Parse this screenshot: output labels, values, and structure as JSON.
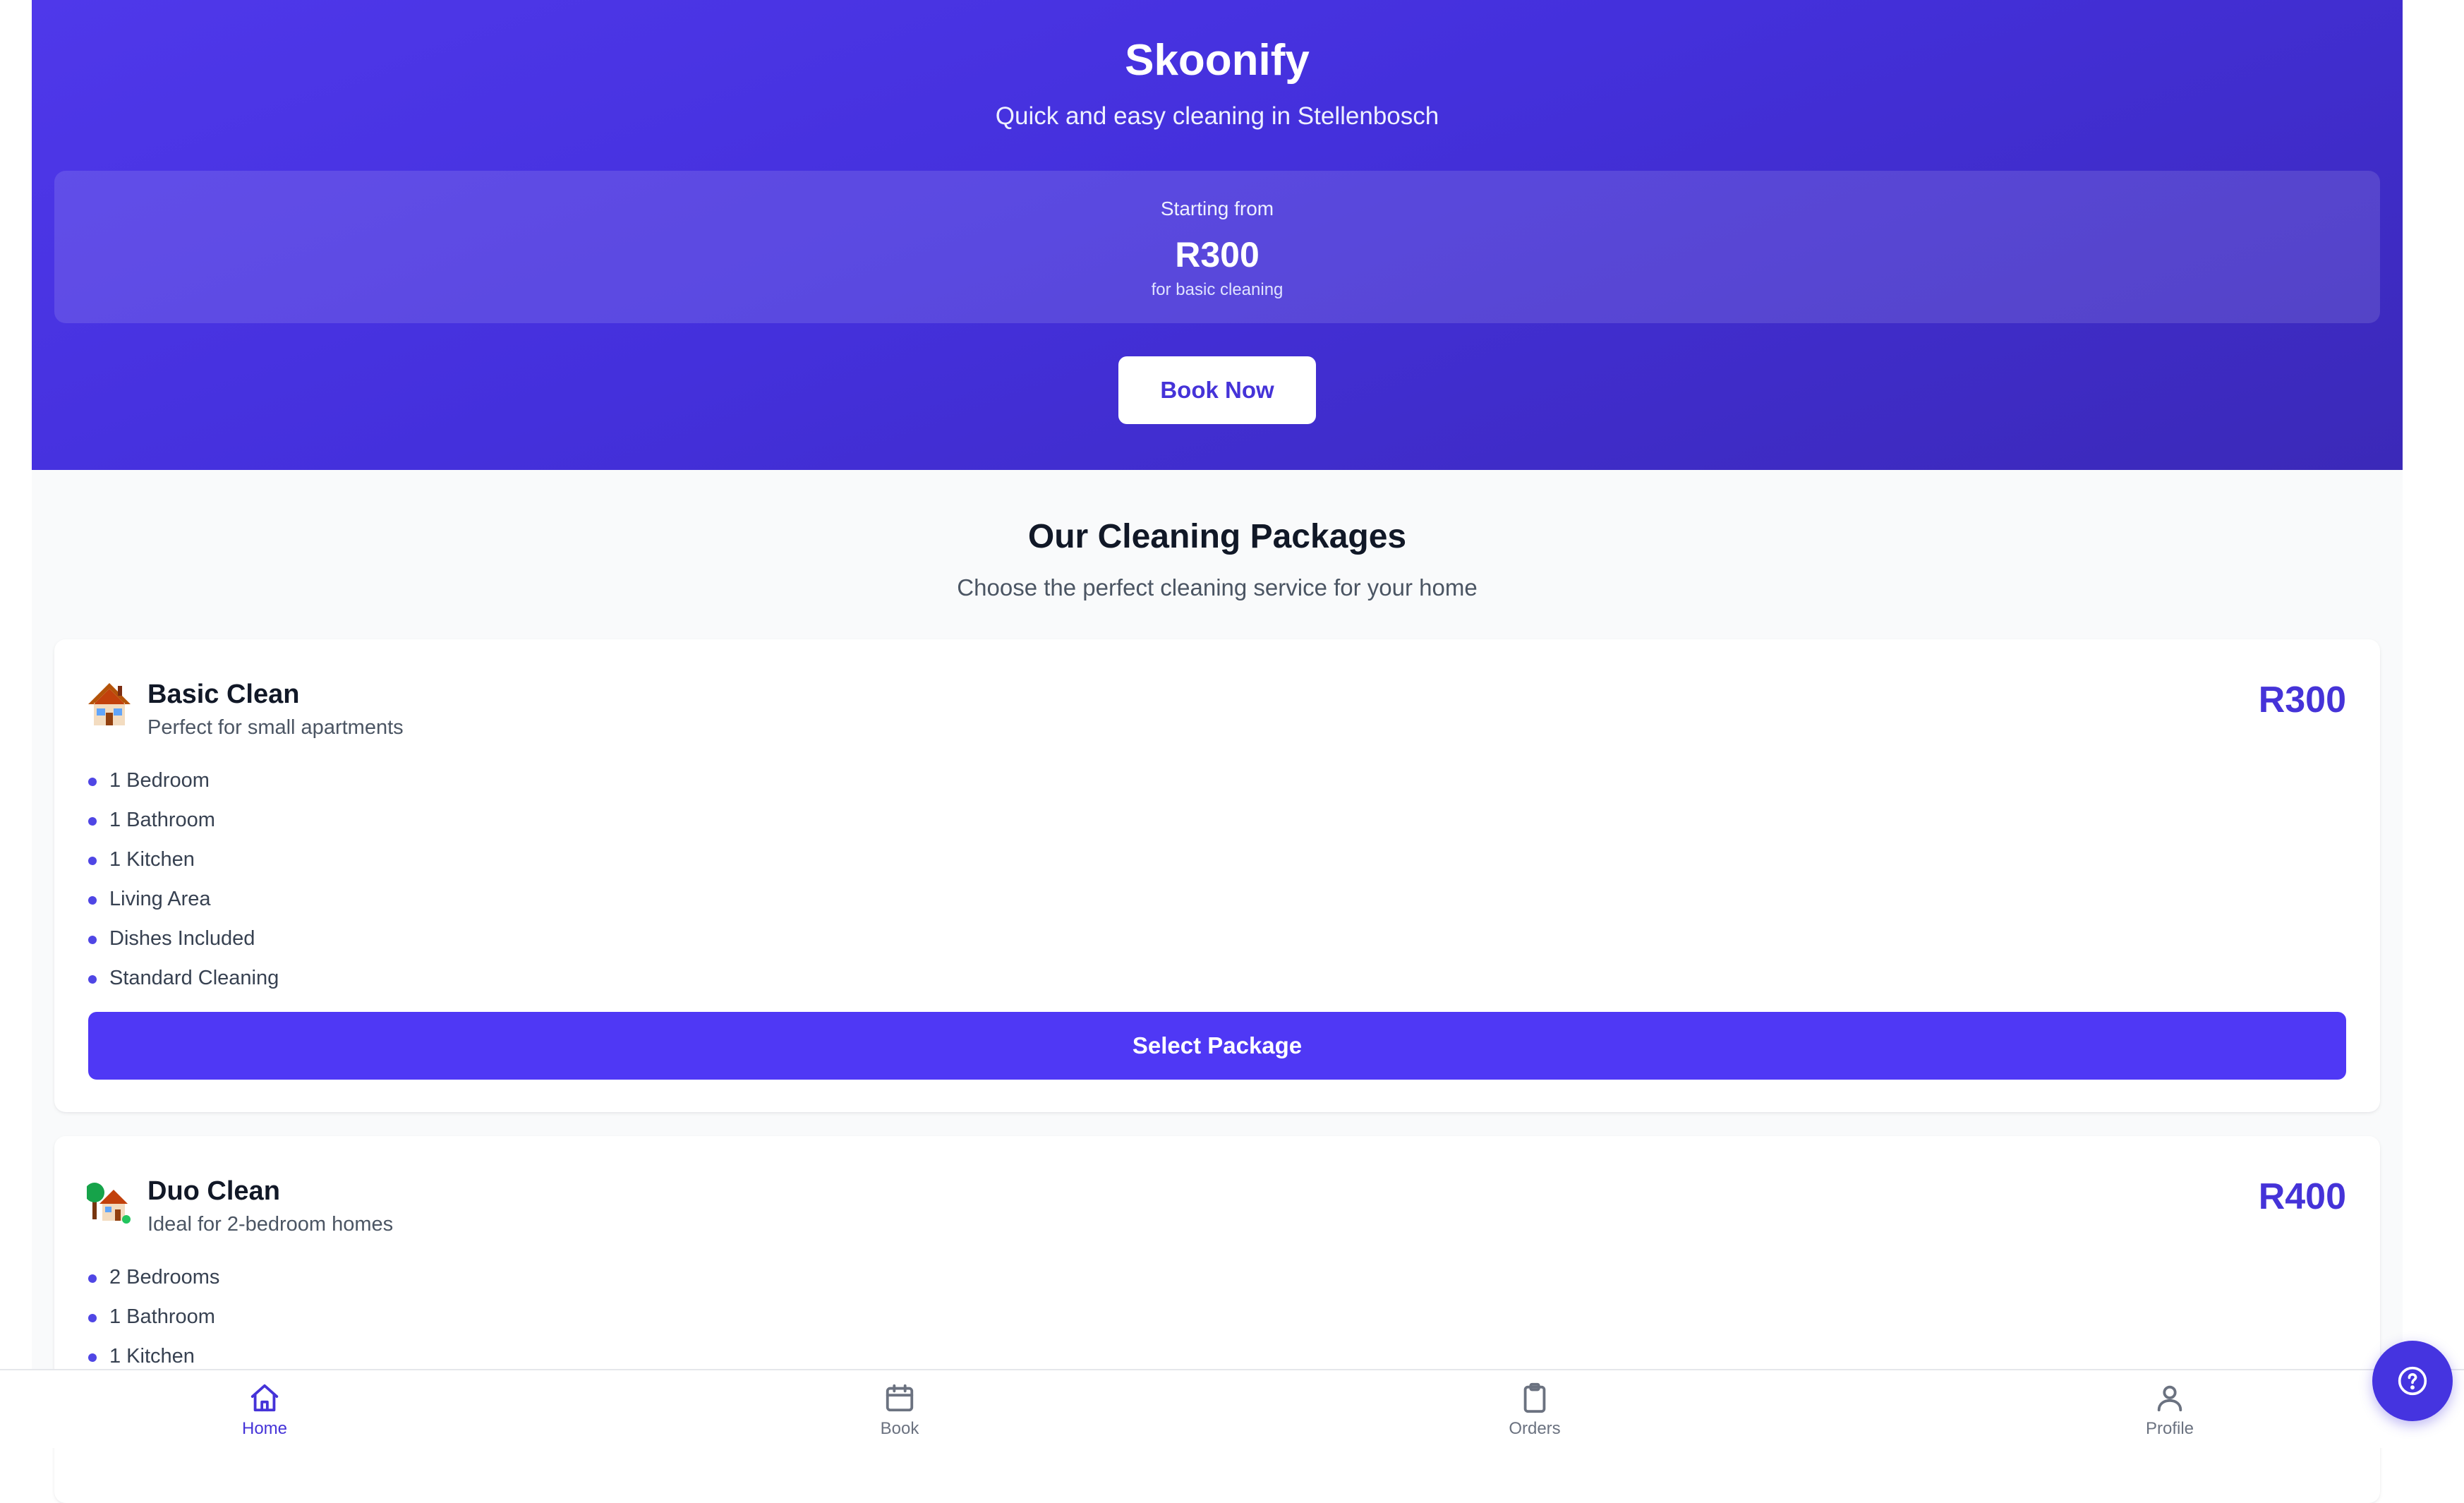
{
  "hero": {
    "title": "Skoonify",
    "subtitle": "Quick and easy cleaning in Stellenbosch",
    "price_box": {
      "label": "Starting from",
      "amount": "R300",
      "note": "for basic cleaning"
    },
    "cta_label": "Book Now"
  },
  "packages_section": {
    "title": "Our Cleaning Packages",
    "subtitle": "Choose the perfect cleaning service for your home"
  },
  "packages": [
    {
      "icon": "house-icon",
      "name": "Basic Clean",
      "description": "Perfect for small apartments",
      "price": "R300",
      "features": [
        "1 Bedroom",
        "1 Bathroom",
        "1 Kitchen",
        "Living Area",
        "Dishes Included",
        "Standard Cleaning"
      ],
      "button_label": "Select Package"
    },
    {
      "icon": "house-with-garden-icon",
      "name": "Duo Clean",
      "description": "Ideal for 2-bedroom homes",
      "price": "R400",
      "features": [
        "2 Bedrooms",
        "1 Bathroom",
        "1 Kitchen"
      ]
    }
  ],
  "bottom_nav": [
    {
      "label": "Home",
      "icon": "home-icon",
      "active": true
    },
    {
      "label": "Book",
      "icon": "calendar-icon",
      "active": false
    },
    {
      "label": "Orders",
      "icon": "clipboard-icon",
      "active": false
    },
    {
      "label": "Profile",
      "icon": "user-icon",
      "active": false
    }
  ],
  "help_button": {
    "icon": "help-circle-icon"
  },
  "colors": {
    "accent": "#4533d8",
    "button": "#4f38f5",
    "hero_start": "#4f38ea",
    "hero_end": "#3b29b8"
  }
}
